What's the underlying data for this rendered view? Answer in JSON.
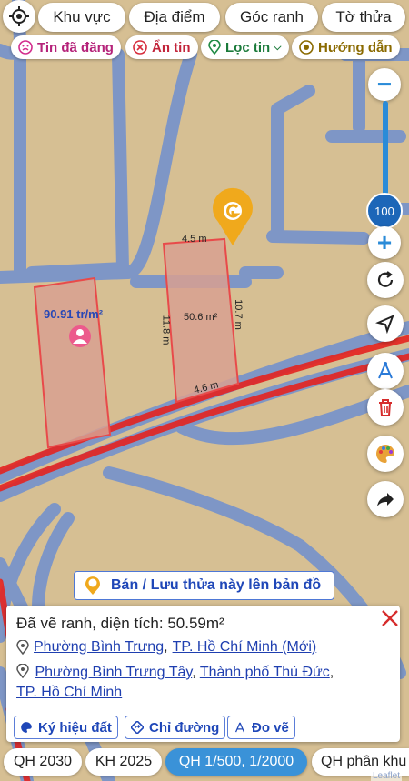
{
  "top_bar": {
    "buttons": [
      "Khu vực",
      "Địa điểm",
      "Góc ranh",
      "Tờ thửa"
    ]
  },
  "filters": {
    "posted": "Tin đã đăng",
    "hidden": "Ẩn tin",
    "filter": "Lọc tin",
    "guide": "Hướng dẫn"
  },
  "zoom": {
    "level": "100"
  },
  "map": {
    "plot_left": {
      "price": "90.91 tr/m²"
    },
    "plot_right": {
      "area": "50.6 m²",
      "top_edge": "4.5 m",
      "bottom_edge": "4.6 m",
      "left_edge": "11.8 m",
      "right_edge": "10.7 m"
    },
    "sell_button": "Bán / Lưu thửa này lên bản đồ"
  },
  "panel": {
    "title": "Đã vẽ ranh, diện tích: 50.59m²",
    "address_new": {
      "ward": "Phường Bình Trưng",
      "sep": ",",
      "city": "TP. Hồ Chí Minh (Mới)"
    },
    "address_old": {
      "ward": "Phường Bình Trưng Tây",
      "sep1": ",",
      "district": "Thành phố Thủ Đức",
      "sep2": ",",
      "city": "TP. Hồ Chí Minh"
    },
    "actions": [
      "Ký hiệu đất",
      "Chỉ đường",
      "Đo vẽ"
    ]
  },
  "bottom_tabs": [
    "QH 2030",
    "KH 2025",
    "QH 1/500, 1/2000",
    "QH phân khu"
  ],
  "attribution": "Leaflet",
  "colors": {
    "accent": "#2a8bd8",
    "active_tab": "#3a92d8",
    "road_red": "#e52320",
    "road_blue": "#4f7fd6",
    "plot_border": "#e84a4a"
  }
}
